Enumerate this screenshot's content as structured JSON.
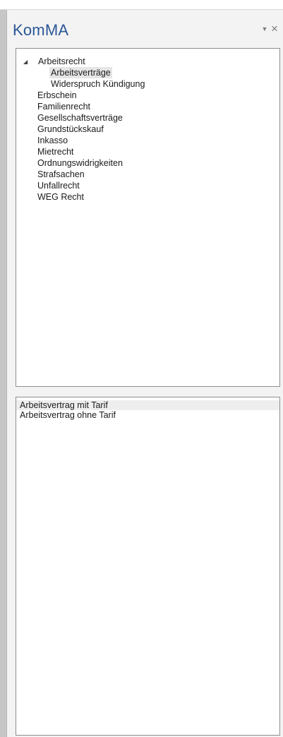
{
  "pane": {
    "title": "KomMA",
    "dropdown_glyph": "▼",
    "close_glyph": "×"
  },
  "tree": {
    "root": {
      "label": "Arbeitsrecht",
      "expander_glyph": "◢",
      "children": [
        "Arbeitsverträge",
        "Widerspruch Kündigung"
      ]
    },
    "items": [
      "Erbschein",
      "Familienrecht",
      "Gesellschaftsverträge",
      "Grundstückskauf",
      "Inkasso",
      "Mietrecht",
      "Ordnungswidrigkeiten",
      "Strafsachen",
      "Unfallrecht",
      "WEG Recht"
    ]
  },
  "list": {
    "items": [
      "Arbeitsvertrag mit Tarif",
      "Arbeitsvertrag ohne Tarif"
    ]
  },
  "colors": {
    "title": "#2b5797",
    "pane_background": "#f3f3f3",
    "selection": "#e5e5e5"
  }
}
